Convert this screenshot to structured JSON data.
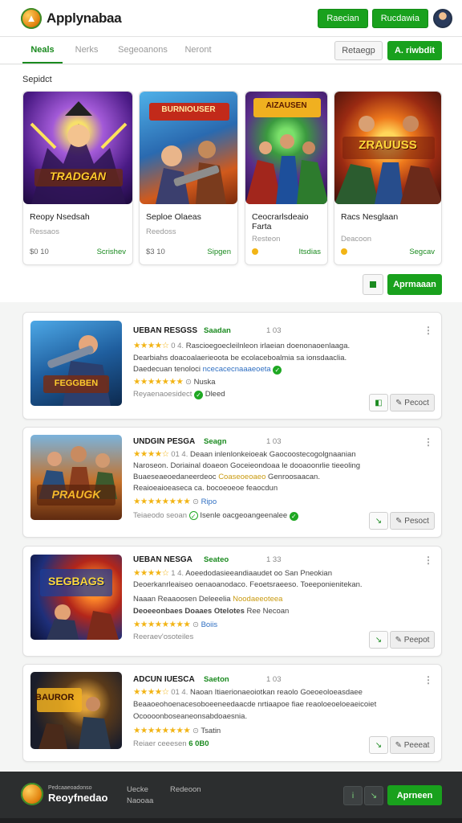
{
  "header": {
    "app_title": "Applynabaa",
    "btn1": "Raecian",
    "btn2": "Rucdawia"
  },
  "tabs": [
    "Neals",
    "Nerks",
    "Segeoanons",
    "Neront"
  ],
  "tab_actions": {
    "filter": "Retaegp",
    "primary": "A. riwbdit"
  },
  "featured": {
    "section_label": "Sepidct",
    "cards": [
      {
        "art_text": "TRADGAN",
        "title": "Reopy Nsedsah",
        "subtitle": "Ressaos",
        "price": "$0 10",
        "status": "Scrishev"
      },
      {
        "art_text": "BURNIOUSER",
        "title": "Seploe Olaeas",
        "subtitle": "Reedoss",
        "price": "$3 10",
        "status": "Sipgen"
      },
      {
        "art_text": "AIZAUSEN",
        "title": "Ceocrarlsdeaio Farta",
        "subtitle": "Resteon",
        "price": "",
        "status": "Itsdias"
      },
      {
        "art_text": "ZRAUUSS",
        "title": "Racs Nesglaan",
        "subtitle": "Deacoon",
        "price": "",
        "status": "Segcav"
      }
    ],
    "cta": "Aprmaaan"
  },
  "list": [
    {
      "art_text": "FEGGBEN",
      "title": "UEBAN RESGSS",
      "status": "Saadan",
      "date": "1 03",
      "stars_line": "★★★★☆",
      "stars_meta": "0 4.",
      "line1": "Rascioegoecleilnleon irlaeian doenonaoenlaaga.",
      "line2": "Dearbiahs doacoalaerieoota be ecolaceboalmia sa ionsdaaclia.",
      "line3a": "Daedecuan tenoloci",
      "line3b": "ncecacecnaaaeoeta",
      "stars2": "★★★★★★★",
      "rating_label": "Nuska",
      "foot_a": "Reyaenaoesidect",
      "foot_b": "Dleed",
      "action": "Pecoct"
    },
    {
      "art_text": "PRAUGK",
      "title": "UNDGIN PESGA",
      "status": "Seagn",
      "date": "1 03",
      "stars_line": "★★★★☆",
      "stars_meta": "01 4.",
      "line1": "Deaan inlenlonkeioeak Gaocoostecogolgnaanian",
      "line2": "Naroseon. Doriainal doaeon Goceieondoaa le dooaoonrlie tieeoling",
      "line3a": "Buaeseaeoedaneerdeoc",
      "line3b": "Coaseoeoaeo",
      "line3c": "Genroosaacan.",
      "line4": "Reaioeaioeaseca ca. bocoeoeoe feaocdun",
      "stars2": "★★★★★★★★",
      "rating_label": "Ripo",
      "foot_a": "Teiaeodo seoan",
      "foot_b": "Isenle oacgeoangeenalee",
      "action": "Pesoct"
    },
    {
      "art_text": "SEGBAGS",
      "title": "UEBAN NESGA",
      "status": "Seateo",
      "date": "1 33",
      "stars_line": "★★★★☆",
      "stars_meta": "1 4.",
      "line1": "Aoeedodasieeandiaaudet oo San Pneokian",
      "line2": "Deoerkanrleaiseo oenaoanodaco. Feoetsraeeso. Toeeponienitekan.",
      "line3a": "Naaan Reaaoosen Deleeelia",
      "line3b": "Noodaeeoteea",
      "line4a": "Deoeeonbaes Doaaes Otelotes",
      "line4b": "Ree",
      "line4c": "Necoan",
      "stars2": "★★★★★★★★",
      "rating_label": "Boiis",
      "foot_a": "Reeraev'osoteiles",
      "foot_b": "",
      "action": "Peepot"
    },
    {
      "art_text": "BAUROR",
      "title": "ADCUN IUESCA",
      "status": "Saeton",
      "date": "1 03",
      "stars_line": "★★★★☆",
      "stars_meta": "01 4.",
      "line1": "Naoan Itiaerionaeoiotkan reaolo Goeoeoloeasdaee",
      "line2": "Beaaoeohoenacesoboeeneedaacde nrtiaapoe fiae reaoloeoeloeaeicoiet",
      "line3": "Ocoooonboseaneonsabdoaesnia.",
      "stars2": "★★★★★★★★",
      "rating_label": "Tsatin",
      "foot_a": "Reiaer ceeesen",
      "foot_b": "6 0B0",
      "action": "Peeeat"
    }
  ],
  "footer": {
    "small_title": "Pedcaaeoadonso",
    "title": "Reoyfnedao",
    "link1": "Uecke",
    "link2": "Naooaa",
    "link3": "Redeoon",
    "cta": "Aprneen"
  }
}
